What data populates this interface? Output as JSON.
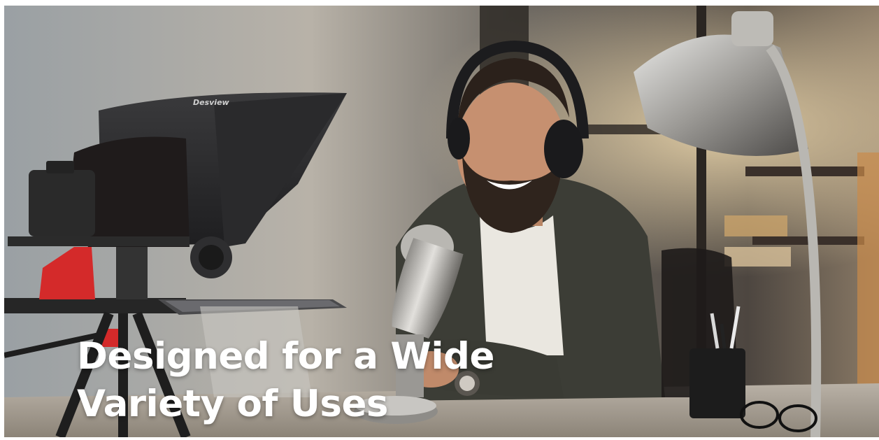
{
  "banner": {
    "headline_line1": "Designed for a Wide",
    "headline_line2": "Variety of Uses",
    "teleprompter_brand": "Desview"
  },
  "colors": {
    "headline": "#ffffff",
    "accent_red": "#d42a2a",
    "background_dark": "#3a3632"
  }
}
